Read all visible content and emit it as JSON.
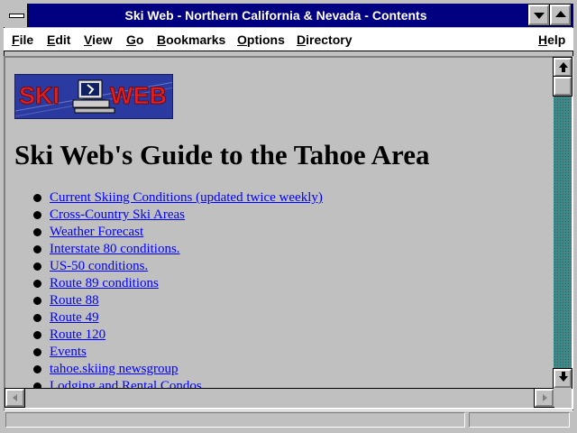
{
  "window": {
    "title": "Ski Web - Northern California & Nevada - Contents"
  },
  "menu": {
    "items": [
      "File",
      "Edit",
      "View",
      "Go",
      "Bookmarks",
      "Options",
      "Directory"
    ],
    "help": "Help"
  },
  "page": {
    "logo_text": "SKI WEB",
    "heading": "Ski Web's Guide to the Tahoe Area",
    "links": [
      "Current Skiing Conditions (updated twice weekly)",
      "Cross-Country Ski Areas",
      "Weather Forecast",
      "Interstate 80 conditions.",
      "US-50 conditions.",
      "Route 89 conditions ",
      "Route 88",
      "Route 49",
      "Route 120",
      "Events",
      "tahoe.skiing newsgroup",
      "Lodging and Rental Condos"
    ]
  },
  "status": {
    "text": "",
    "progress": 0
  },
  "colors": {
    "titlebar": "#000080",
    "link": "#0000ff",
    "background": "#c0c0c0",
    "scrollbar_track": "#3a8a8a"
  }
}
